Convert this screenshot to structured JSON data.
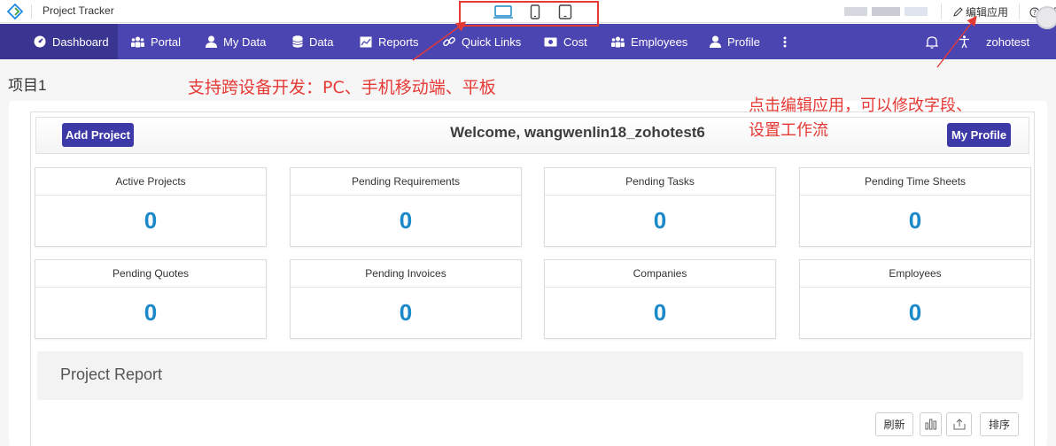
{
  "topbar": {
    "app_title": "Project Tracker",
    "edit_app_label": "编辑应用",
    "help_label": "帮助"
  },
  "nav": {
    "items": [
      {
        "label": "Dashboard",
        "icon": "dashboard-icon",
        "active": true
      },
      {
        "label": "Portal",
        "icon": "people-icon"
      },
      {
        "label": "My Data",
        "icon": "user-icon"
      },
      {
        "label": "Data",
        "icon": "database-icon"
      },
      {
        "label": "Reports",
        "icon": "chart-icon"
      },
      {
        "label": "Quick Links",
        "icon": "link-icon"
      },
      {
        "label": "Cost",
        "icon": "money-icon"
      },
      {
        "label": "Employees",
        "icon": "people-icon"
      },
      {
        "label": "Profile",
        "icon": "user-icon"
      }
    ],
    "username": "zohotest"
  },
  "annotations": {
    "cross_device": "支持跨设备开发：PC、手机移动端、平板",
    "edit_hint_line1": "点击编辑应用，可以修改字段、",
    "edit_hint_line2": "设置工作流"
  },
  "page": {
    "title": "项目1"
  },
  "dashboard": {
    "add_project_label": "Add Project",
    "welcome_text": "Welcome, wangwenlin18_zohotest6",
    "my_profile_label": "My Profile",
    "tiles": [
      {
        "label": "Active Projects",
        "value": "0"
      },
      {
        "label": "Pending Requirements",
        "value": "0"
      },
      {
        "label": "Pending Tasks",
        "value": "0"
      },
      {
        "label": "Pending Time Sheets",
        "value": "0"
      },
      {
        "label": "Pending Quotes",
        "value": "0"
      },
      {
        "label": "Pending Invoices",
        "value": "0"
      },
      {
        "label": "Companies",
        "value": "0"
      },
      {
        "label": "Employees",
        "value": "0"
      }
    ]
  },
  "report": {
    "title": "Project Report",
    "refresh_label": "刷新",
    "sort_label": "排序"
  },
  "colors": {
    "nav": "#4b45b2",
    "accent": "#1a88c9",
    "annotation": "#e53935"
  }
}
